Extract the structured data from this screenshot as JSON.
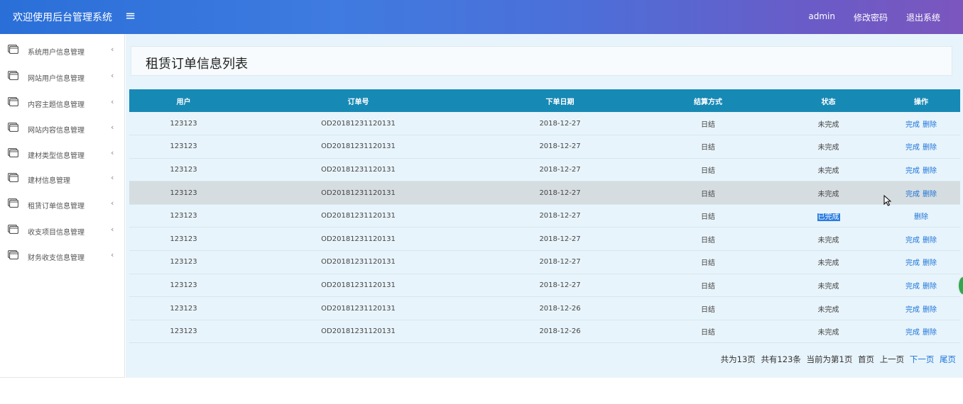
{
  "header": {
    "brand": "欢迎使用后台管理系统",
    "menu_toggle": "≡",
    "user": "admin",
    "change_password": "修改密码",
    "logout": "退出系统"
  },
  "sidebar": {
    "items": [
      {
        "label": "系统用户信息管理",
        "icon": "window-icon"
      },
      {
        "label": "网站用户信息管理",
        "icon": "window-icon"
      },
      {
        "label": "内容主题信息管理",
        "icon": "window-icon"
      },
      {
        "label": "网站内容信息管理",
        "icon": "window-icon"
      },
      {
        "label": "建材类型信息管理",
        "icon": "window-icon"
      },
      {
        "label": "建材信息管理",
        "icon": "window-icon"
      },
      {
        "label": "租赁订单信息管理",
        "icon": "window-icon"
      },
      {
        "label": "收支项目信息管理",
        "icon": "window-icon"
      },
      {
        "label": "财务收支信息管理",
        "icon": "window-icon"
      }
    ],
    "chevron": "‹"
  },
  "page": {
    "title": "租赁订单信息列表"
  },
  "table": {
    "headers": [
      "用户",
      "订单号",
      "下单日期",
      "结算方式",
      "状态",
      "操作"
    ],
    "rows": [
      {
        "user": "123123",
        "order_no": "OD20181231120131",
        "date": "2018-12-27",
        "settle": "日结",
        "status": "未完成",
        "actions": [
          "完成",
          "删除"
        ]
      },
      {
        "user": "123123",
        "order_no": "OD20181231120131",
        "date": "2018-12-27",
        "settle": "日结",
        "status": "未完成",
        "actions": [
          "完成",
          "删除"
        ]
      },
      {
        "user": "123123",
        "order_no": "OD20181231120131",
        "date": "2018-12-27",
        "settle": "日结",
        "status": "未完成",
        "actions": [
          "完成",
          "删除"
        ]
      },
      {
        "user": "123123",
        "order_no": "OD20181231120131",
        "date": "2018-12-27",
        "settle": "日结",
        "status": "未完成",
        "actions": [
          "完成",
          "删除"
        ]
      },
      {
        "user": "123123",
        "order_no": "OD20181231120131",
        "date": "2018-12-27",
        "settle": "日结",
        "status": "已完成",
        "actions": [
          "删除"
        ]
      },
      {
        "user": "123123",
        "order_no": "OD20181231120131",
        "date": "2018-12-27",
        "settle": "日结",
        "status": "未完成",
        "actions": [
          "完成",
          "删除"
        ]
      },
      {
        "user": "123123",
        "order_no": "OD20181231120131",
        "date": "2018-12-27",
        "settle": "日结",
        "status": "未完成",
        "actions": [
          "完成",
          "删除"
        ]
      },
      {
        "user": "123123",
        "order_no": "OD20181231120131",
        "date": "2018-12-27",
        "settle": "日结",
        "status": "未完成",
        "actions": [
          "完成",
          "删除"
        ]
      },
      {
        "user": "123123",
        "order_no": "OD20181231120131",
        "date": "2018-12-26",
        "settle": "日结",
        "status": "未完成",
        "actions": [
          "完成",
          "删除"
        ]
      },
      {
        "user": "123123",
        "order_no": "OD20181231120131",
        "date": "2018-12-26",
        "settle": "日结",
        "status": "未完成",
        "actions": [
          "完成",
          "删除"
        ]
      }
    ]
  },
  "pager": {
    "total_pages": "共为13页",
    "total_records": "共有123条",
    "current": "当前为第1页",
    "first": "首页",
    "prev": "上一页",
    "next": "下一页",
    "last": "尾页"
  },
  "colors": {
    "header_gradient_start": "#2a6fd8",
    "header_gradient_end": "#7b56be",
    "table_header": "#1789b5",
    "link": "#1a73d9",
    "content_bg": "#e8f4fb"
  }
}
